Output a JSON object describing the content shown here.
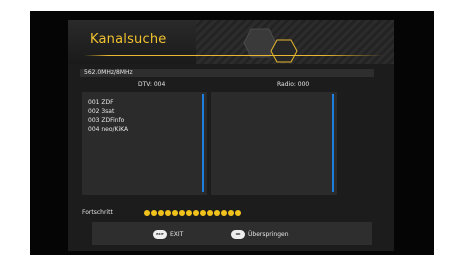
{
  "title": "Kanalsuche",
  "frequency": "562.0MHz/8MHz",
  "columns": {
    "tv": "DTV: 004",
    "radio": "Radio: 000"
  },
  "tv_channels": [
    "001 ZDF",
    "002 3sat",
    "003 ZDFinfo",
    "004 neo/KiKA"
  ],
  "radio_channels": [],
  "progress": {
    "label": "Fortschritt",
    "filled_dots": 14
  },
  "footer": {
    "exit_key": "EXIT",
    "exit_label": "EXIT",
    "skip_key": "OK",
    "skip_label": "Überspringen"
  },
  "colors": {
    "accent": "#f1c21b",
    "scrollbar": "#1f7de0"
  }
}
